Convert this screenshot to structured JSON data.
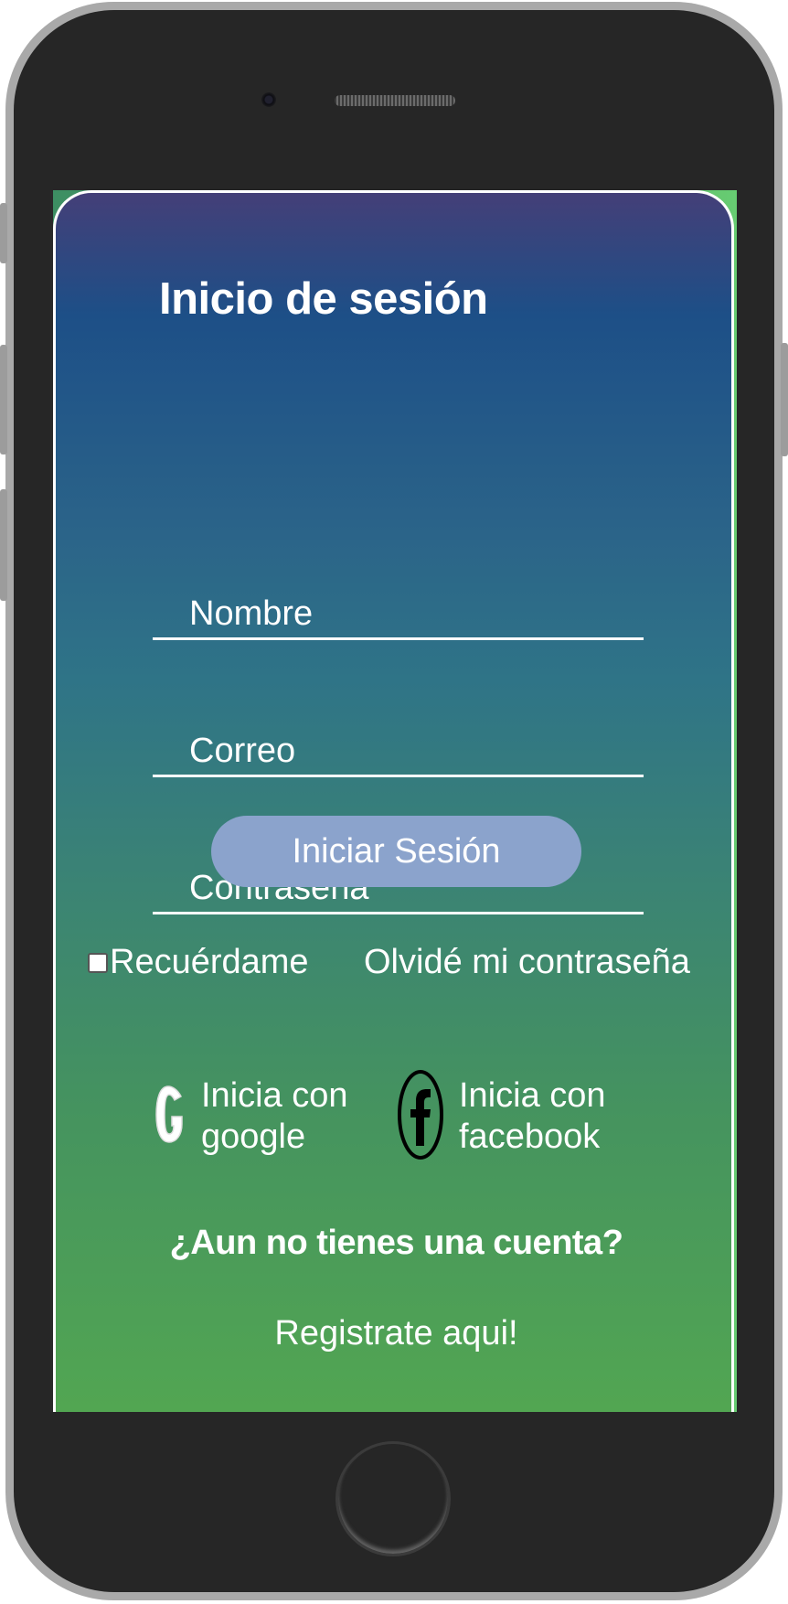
{
  "screen": {
    "title": "Inicio de sesión",
    "fields": {
      "name_placeholder": "Nombre",
      "name_value": "",
      "email_placeholder": "Correo",
      "email_value": "",
      "password_placeholder": "Contraseña",
      "password_value": ""
    },
    "login_button_label": "Iniciar Sesión",
    "remember_label": "Recuérdame",
    "remember_checked": false,
    "forgot_label": "Olvidé mi contraseña",
    "social": {
      "google_line1": "Inicia con",
      "google_line2": "google",
      "facebook_line1": "Inicia con",
      "facebook_line2": "facebook"
    },
    "no_account_text": "¿Aun no tienes una cuenta?",
    "register_label": "Registrate aqui!"
  },
  "colors": {
    "gradient_top": "#443f78",
    "gradient_mid": "#2f7487",
    "gradient_bottom": "#52a652",
    "button_bg": "#8ba3cc",
    "text": "#ffffff"
  },
  "icons": [
    "google-icon",
    "facebook-icon"
  ]
}
